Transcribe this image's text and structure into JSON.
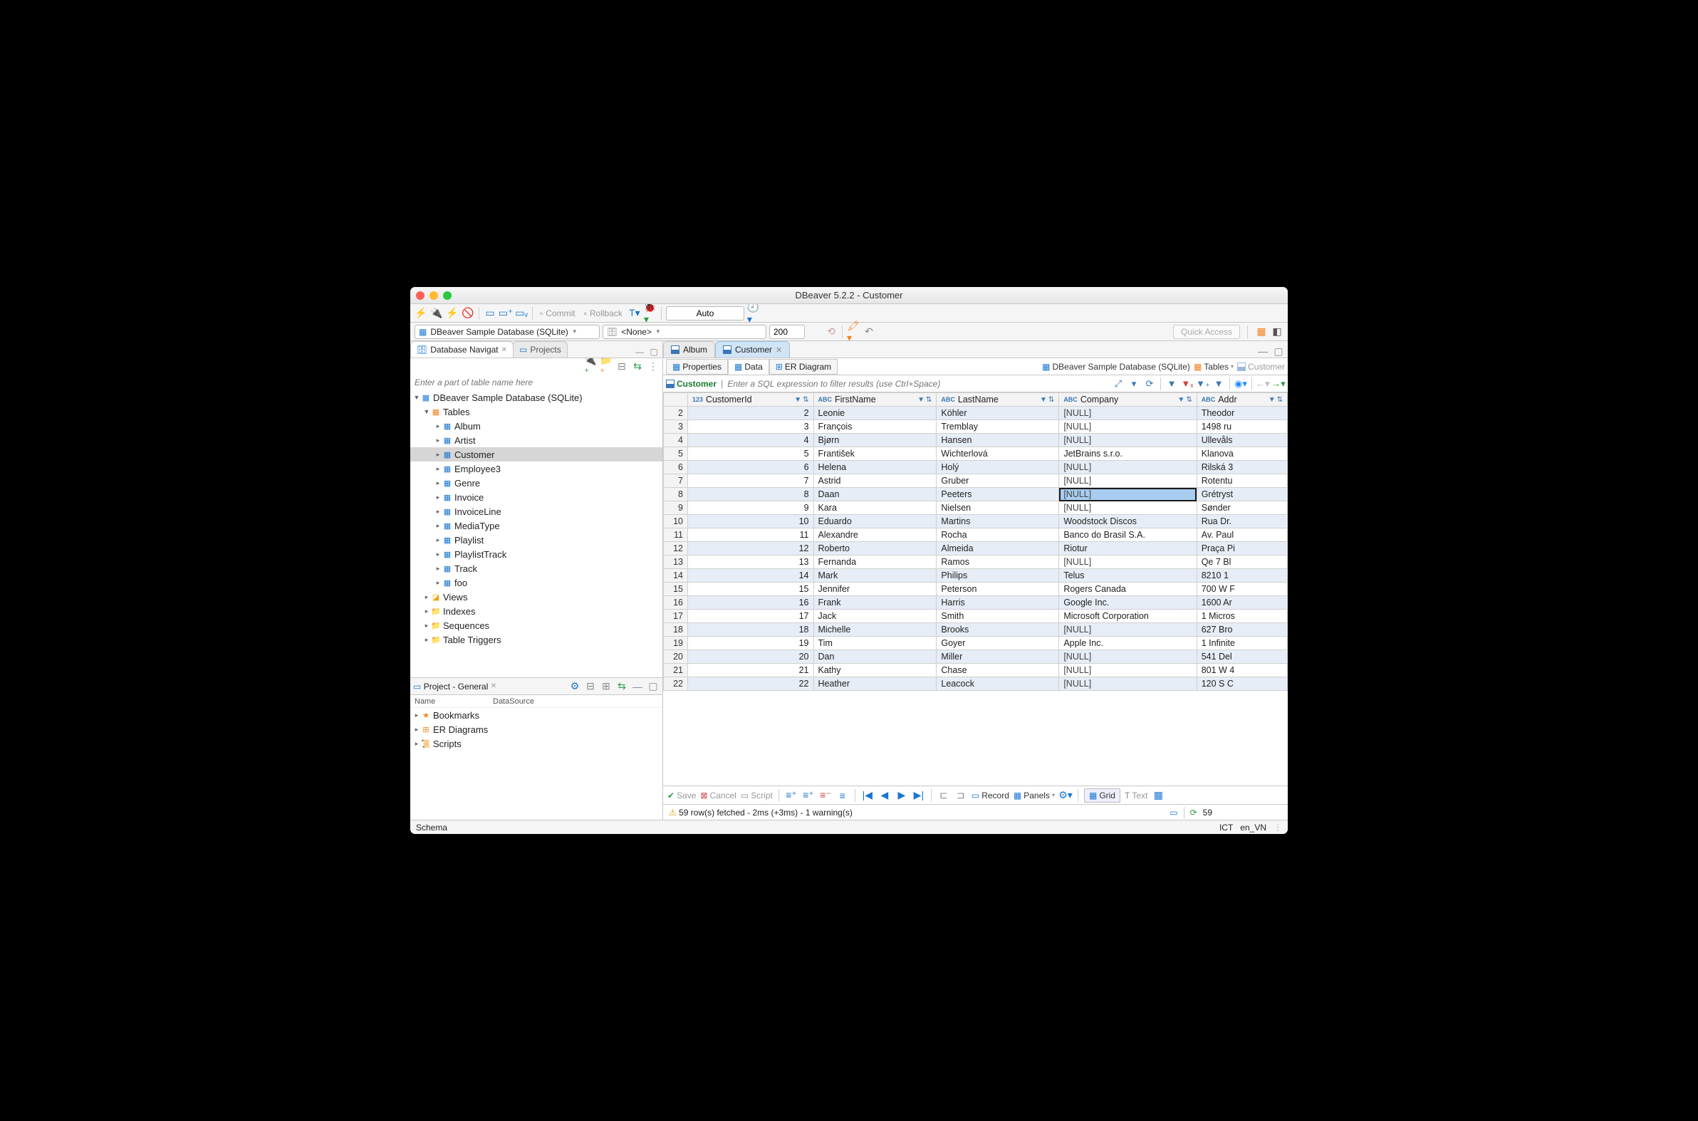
{
  "window": {
    "title": "DBeaver 5.2.2 - Customer"
  },
  "toolbar1": {
    "commit": "Commit",
    "rollback": "Rollback",
    "auto": "Auto"
  },
  "toolbar2": {
    "datasource": "DBeaver Sample Database (SQLite)",
    "schema": "<None>",
    "limit": "200",
    "quick_access": "Quick Access"
  },
  "left_tabs": {
    "nav": "Database Navigat",
    "projects": "Projects"
  },
  "nav": {
    "filter_placeholder": "Enter a part of table name here",
    "root": "DBeaver Sample Database (SQLite)",
    "tables_label": "Tables",
    "tables": [
      "Album",
      "Artist",
      "Customer",
      "Employee3",
      "Genre",
      "Invoice",
      "InvoiceLine",
      "MediaType",
      "Playlist",
      "PlaylistTrack",
      "Track",
      "foo"
    ],
    "views": "Views",
    "folders": [
      "Indexes",
      "Sequences",
      "Table Triggers"
    ]
  },
  "project": {
    "title": "Project - General",
    "col_name": "Name",
    "col_ds": "DataSource",
    "items": [
      "Bookmarks",
      "ER Diagrams",
      "Scripts"
    ]
  },
  "editor": {
    "tabs": [
      "Album",
      "Customer"
    ],
    "subtabs": {
      "properties": "Properties",
      "data": "Data",
      "er": "ER Diagram"
    },
    "breadcrumb": {
      "ds": "DBeaver Sample Database (SQLite)",
      "tables": "Tables",
      "table": "Customer"
    },
    "filter_entity": "Customer",
    "filter_placeholder": "Enter a SQL expression to filter results (use Ctrl+Space)",
    "columns": [
      {
        "name": "CustomerId",
        "type": "123"
      },
      {
        "name": "FirstName",
        "type": "ABC"
      },
      {
        "name": "LastName",
        "type": "ABC"
      },
      {
        "name": "Company",
        "type": "ABC"
      },
      {
        "name": "Addr",
        "type": "ABC"
      }
    ],
    "rows": [
      {
        "n": 2,
        "id": 2,
        "fn": "Leonie",
        "ln": "Köhler",
        "co": "[NULL]",
        "ad": "Theodor"
      },
      {
        "n": 3,
        "id": 3,
        "fn": "François",
        "ln": "Tremblay",
        "co": "[NULL]",
        "ad": "1498 ru"
      },
      {
        "n": 4,
        "id": 4,
        "fn": "Bjørn",
        "ln": "Hansen",
        "co": "[NULL]",
        "ad": "Ullevåls"
      },
      {
        "n": 5,
        "id": 5,
        "fn": "František",
        "ln": "Wichterlová",
        "co": "JetBrains s.r.o.",
        "ad": "Klanova"
      },
      {
        "n": 6,
        "id": 6,
        "fn": "Helena",
        "ln": "Holý",
        "co": "[NULL]",
        "ad": "Rilská 3"
      },
      {
        "n": 7,
        "id": 7,
        "fn": "Astrid",
        "ln": "Gruber",
        "co": "[NULL]",
        "ad": "Rotentu"
      },
      {
        "n": 8,
        "id": 8,
        "fn": "Daan",
        "ln": "Peeters",
        "co": "[NULL]",
        "ad": "Grétryst",
        "sel": "co"
      },
      {
        "n": 9,
        "id": 9,
        "fn": "Kara",
        "ln": "Nielsen",
        "co": "[NULL]",
        "ad": "Sønder"
      },
      {
        "n": 10,
        "id": 10,
        "fn": "Eduardo",
        "ln": "Martins",
        "co": "Woodstock Discos",
        "ad": "Rua Dr."
      },
      {
        "n": 11,
        "id": 11,
        "fn": "Alexandre",
        "ln": "Rocha",
        "co": "Banco do Brasil S.A.",
        "ad": "Av. Paul"
      },
      {
        "n": 12,
        "id": 12,
        "fn": "Roberto",
        "ln": "Almeida",
        "co": "Riotur",
        "ad": "Praça Pi"
      },
      {
        "n": 13,
        "id": 13,
        "fn": "Fernanda",
        "ln": "Ramos",
        "co": "[NULL]",
        "ad": "Qe 7 Bl"
      },
      {
        "n": 14,
        "id": 14,
        "fn": "Mark",
        "ln": "Philips",
        "co": "Telus",
        "ad": "8210 1"
      },
      {
        "n": 15,
        "id": 15,
        "fn": "Jennifer",
        "ln": "Peterson",
        "co": "Rogers Canada",
        "ad": "700 W F"
      },
      {
        "n": 16,
        "id": 16,
        "fn": "Frank",
        "ln": "Harris",
        "co": "Google Inc.",
        "ad": "1600 Ar"
      },
      {
        "n": 17,
        "id": 17,
        "fn": "Jack",
        "ln": "Smith",
        "co": "Microsoft Corporation",
        "ad": "1 Micros"
      },
      {
        "n": 18,
        "id": 18,
        "fn": "Michelle",
        "ln": "Brooks",
        "co": "[NULL]",
        "ad": "627 Bro"
      },
      {
        "n": 19,
        "id": 19,
        "fn": "Tim",
        "ln": "Goyer",
        "co": "Apple Inc.",
        "ad": "1 Infinite"
      },
      {
        "n": 20,
        "id": 20,
        "fn": "Dan",
        "ln": "Miller",
        "co": "[NULL]",
        "ad": "541 Del"
      },
      {
        "n": 21,
        "id": 21,
        "fn": "Kathy",
        "ln": "Chase",
        "co": "[NULL]",
        "ad": "801 W 4"
      },
      {
        "n": 22,
        "id": 22,
        "fn": "Heather",
        "ln": "Leacock",
        "co": "[NULL]",
        "ad": "120 S C"
      }
    ]
  },
  "bottom": {
    "save": "Save",
    "cancel": "Cancel",
    "script": "Script",
    "record": "Record",
    "panels": "Panels",
    "grid": "Grid",
    "text": "Text",
    "status": "59 row(s) fetched - 2ms (+3ms) - 1 warning(s)",
    "count": "59"
  },
  "appstatus": {
    "schema": "Schema",
    "tz": "ICT",
    "locale": "en_VN"
  }
}
